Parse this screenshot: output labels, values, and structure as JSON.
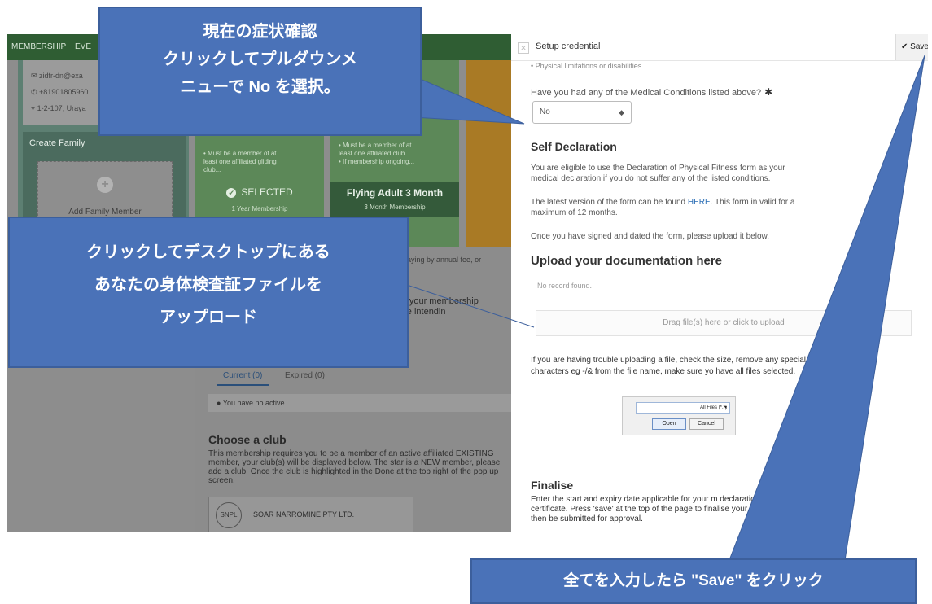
{
  "background": {
    "nav": {
      "item1": "MEMBERSHIP",
      "item2": "EVE"
    },
    "contact": {
      "email": "zidfr-dn@exa",
      "phone": "+81901805960",
      "address": "1-2-107, Uraya"
    },
    "create_family": {
      "title": "Create Family",
      "add_label": "Add Family Member"
    },
    "cards": {
      "card1_bullets": "• Must be a member of at\nleast one affiliated gliding\nclub...",
      "card1_selected": "SELECTED",
      "card1_sub": "1 Year Membership",
      "card2_bullets": "• Must be a member of at\nleast one affiliated club\n• If membership ongoing...",
      "card2_title": "Flying Adult 3 Month",
      "card2_sub": "3 Month Membership"
    },
    "pay_text": "paying by annual fee, or",
    "membership_text": "or your membership\nare intendin",
    "tabs": {
      "current": "Current (0)",
      "expired": "Expired (0)"
    },
    "no_active": "You have no active.",
    "choose_club": {
      "title": "Choose a club",
      "text": "This membership requires you to be a member of an active affiliated EXISTING member, your club(s) will be displayed below. The star is a NEW member, please add a club. Once the club is highlighted in the Done at the top right of the pop up screen.",
      "club_logo": "SNPL",
      "club_name": "SOAR NARROMINE PTY LTD."
    }
  },
  "modal": {
    "title": "Setup credential",
    "save_label": "✔ Save",
    "physical_note": "• Physical limitations or disabilities",
    "question": "Have you had any of the Medical Conditions listed above?",
    "required_mark": "✱",
    "select_value": "No",
    "self_declaration": {
      "heading": "Self Declaration",
      "p1": "You are eligible to use the Declaration of Physical Fitness form as your medical declaration if you do not suffer any of the listed conditions.",
      "p2_before": "The latest version of the form can be found ",
      "p2_link": "HERE",
      "p2_after": ". This form in valid for a maximum of 12 months.",
      "p3": "Once you have signed and dated the form, please upload it below."
    },
    "upload": {
      "heading": "Upload your documentation here",
      "no_record": "No record found.",
      "drop_text": "Drag file(s) here or click to upload",
      "trouble": "If you are having trouble uploading a file, check the size, remove any special characters eg -/& from the file name, make sure yo have all files selected."
    },
    "file_dialog": {
      "filter": "All Files (*.*)",
      "open": "Open",
      "cancel": "Cancel"
    },
    "finalise": {
      "heading": "Finalise",
      "text": "Enter the start and expiry date applicable for your m declaration or certificate. Press 'save' at the top of the page to finalise your c credential will then be submitted for approval."
    }
  },
  "callouts": {
    "c1": [
      "現在の症状確認",
      "クリックしてプルダウンメ",
      "ニューで No を選択。"
    ],
    "c2": [
      "クリックしてデスクトップにある",
      "あなたの身体検査証ファイルを",
      "アップロード"
    ],
    "c3": "全てを入力したら \"Save\" をクリック"
  },
  "colors": {
    "callout": "#4a72b8",
    "nav": "#2f5d33"
  }
}
